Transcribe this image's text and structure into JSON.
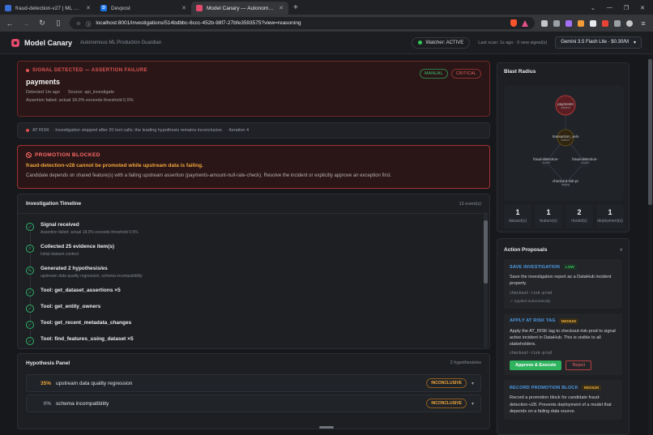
{
  "browser": {
    "tabs": [
      {
        "title": "fraud-detection-v27 | ML Model",
        "favicon_color": "#3b6fd8",
        "favicon_letter": "",
        "active": false
      },
      {
        "title": "Devpost",
        "favicon_color": "#1a73e8",
        "favicon_letter": "D",
        "active": false
      },
      {
        "title": "Model Canary — Autonomous M",
        "favicon_color": "#e24a6c",
        "favicon_letter": "",
        "active": true
      }
    ],
    "url": "localhost:8001/investigations/514bdbbc-6ccc-452b-98f7-27bfe3593575?view=reasoning"
  },
  "app": {
    "name": "Model Canary",
    "tagline": "Autonomous ML Production Guardian",
    "watcher": "Watcher: ACTIVE",
    "last_scan": "Last scan: 1s ago · 0 new signal(s)",
    "model": "Gemini 3.5 Flash Lite · $0.30/M",
    "model_caret": "▾"
  },
  "signal": {
    "label": "SIGNAL DETECTED — ASSERTION FAILURE",
    "badges": [
      "MANUAL",
      "CRITICAL"
    ],
    "title": "payments",
    "detected": "Detected 1m ago",
    "source": "Source: api_investigate",
    "assertion": "Assertion failed: actual 18.0% exceeds threshold 0.5%"
  },
  "status_bar": {
    "state": "AT RISK",
    "message": "· Investigation stopped after 20 tool calls; the leading hypothesis remains inconclusive.",
    "iteration": "· Iteration 4"
  },
  "promotion": {
    "label": "PROMOTION BLOCKED",
    "title": "fraud-detection-v28 cannot be promoted while upstream data is failing.",
    "description": "Candidate depends on shared feature(s) with a failing upstream assertion (payments-amount-null-rate-check). Resolve the incident or explicitly approve an exception first."
  },
  "timeline": {
    "title": "Investigation Timeline",
    "count": "13 event(s)",
    "events": [
      {
        "icon": "check-icon",
        "glyph": "✓",
        "title": "Signal received",
        "sub": "Assertion failed: actual 18.0% exceeds threshold 0.5%"
      },
      {
        "icon": "search-icon",
        "glyph": "⌕",
        "title": "Collected 25 evidence item(s)",
        "sub": "Initial dataset context"
      },
      {
        "icon": "pencil-icon",
        "glyph": "✎",
        "title": "Generated 2 hypothesis/es",
        "sub": "upstream data quality regression, schema incompatibility"
      },
      {
        "icon": "check-icon",
        "glyph": "✓",
        "title": "Tool: get_dataset_assertions ×5",
        "sub": ""
      },
      {
        "icon": "check-icon",
        "glyph": "✓",
        "title": "Tool: get_entity_owners",
        "sub": ""
      },
      {
        "icon": "check-icon",
        "glyph": "✓",
        "title": "Tool: get_recent_metadata_changes",
        "sub": ""
      },
      {
        "icon": "check-icon",
        "glyph": "✓",
        "title": "Tool: find_features_using_dataset ×5",
        "sub": ""
      }
    ]
  },
  "hypotheses": {
    "title": "Hypothesis Panel",
    "count": "2 hypothesis/es",
    "items": [
      {
        "pct": "35%",
        "pct_color": "#f0a63a",
        "name": "upstream data quality regression",
        "status": "INCONCLUSIVE",
        "caret": "▾"
      },
      {
        "pct": "0%",
        "pct_color": "#8a8f96",
        "name": "schema incompatibility",
        "status": "INCONCLUSIVE",
        "caret": "▾"
      }
    ]
  },
  "blast_radius": {
    "title": "Blast Radius",
    "nodes": [
      {
        "label": "payments",
        "sub": "dataset"
      },
      {
        "label": "transaction_velo",
        "sub": "feature"
      },
      {
        "label": "fraud-detection-",
        "sub": "model"
      },
      {
        "label": "fraud-detection-",
        "sub": "model"
      },
      {
        "label": "checkout-risk-pr",
        "sub": "deploy"
      }
    ],
    "stats": [
      {
        "n": "1",
        "label": "dataset(s)"
      },
      {
        "n": "1",
        "label": "feature(s)"
      },
      {
        "n": "2",
        "label": "model(s)"
      },
      {
        "n": "1",
        "label": "deployment(s)"
      }
    ]
  },
  "actions": {
    "title": "Action Proposals",
    "count": "4",
    "items": [
      {
        "name": "SAVE INVESTIGATION",
        "level": "LOW",
        "desc": "Save the investigation report as a DataHub incident property.",
        "target": "checkout-risk-prod",
        "note": "✓ Applied automatically",
        "approve": "",
        "reject": ""
      },
      {
        "name": "APPLY AT RISK TAG",
        "level": "MEDIUM",
        "desc": "Apply the AT_RISK tag to checkout-risk-prod to signal active incident in DataHub. This is visible to all stakeholders.",
        "target": "checkout-risk-prod",
        "note": "",
        "approve": "Approve & Execute",
        "reject": "Reject"
      },
      {
        "name": "RECORD PROMOTION BLOCK",
        "level": "MEDIUM",
        "desc": "Record a promotion block for candidate fraud-detection-v28. Prevents deployment of a model that depends on a failing data source.",
        "target": "",
        "note": "",
        "approve": "",
        "reject": ""
      }
    ]
  }
}
